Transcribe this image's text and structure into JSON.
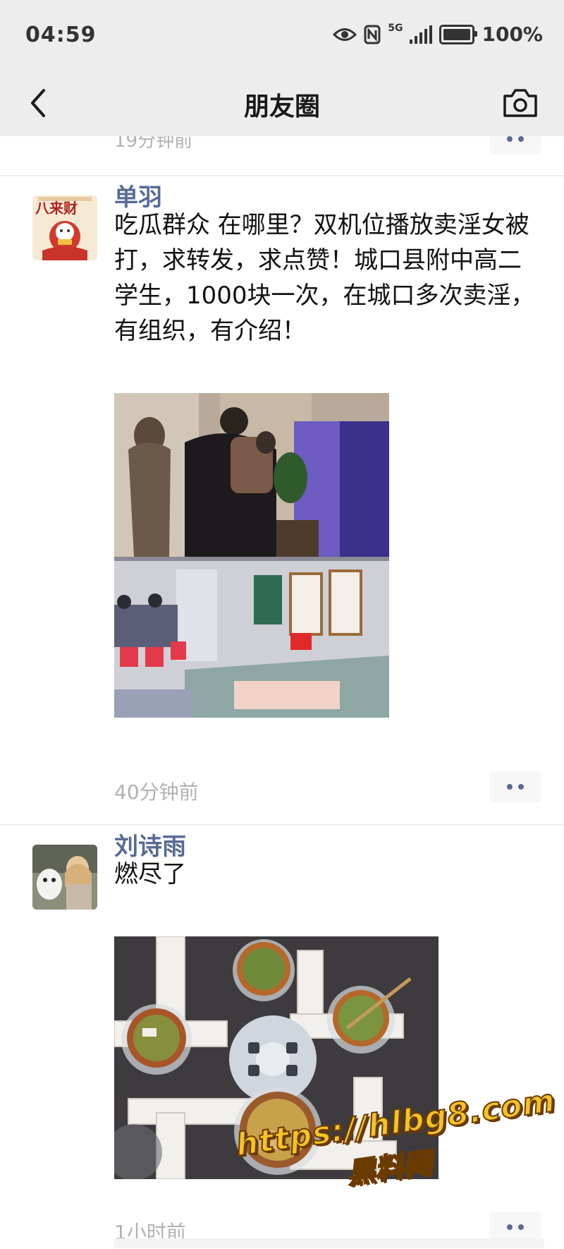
{
  "status_bar": {
    "time": "04:59",
    "network": "5G",
    "battery": "100%"
  },
  "nav": {
    "title": "朋友圈"
  },
  "previous_post": {
    "time": "19分钟前"
  },
  "posts": [
    {
      "author": "单羽",
      "avatar_text": "八来财",
      "text": "吃瓜群众 在哪里？双机位播放卖淫女被打，求转发，求点赞！城口县附中高二学生，1000块一次，在城口多次卖淫，有组织，有介绍！",
      "time": "40分钟前"
    },
    {
      "author": "刘诗雨",
      "text": "燃尽了",
      "time": "1小时前"
    }
  ],
  "watermark": {
    "url": "https://hlbg8.com",
    "name": "黑料网"
  },
  "colors": {
    "bar_bg": "#ededed",
    "author": "#576b95",
    "time": "#b2b2b2",
    "watermark": "#f6c323"
  }
}
